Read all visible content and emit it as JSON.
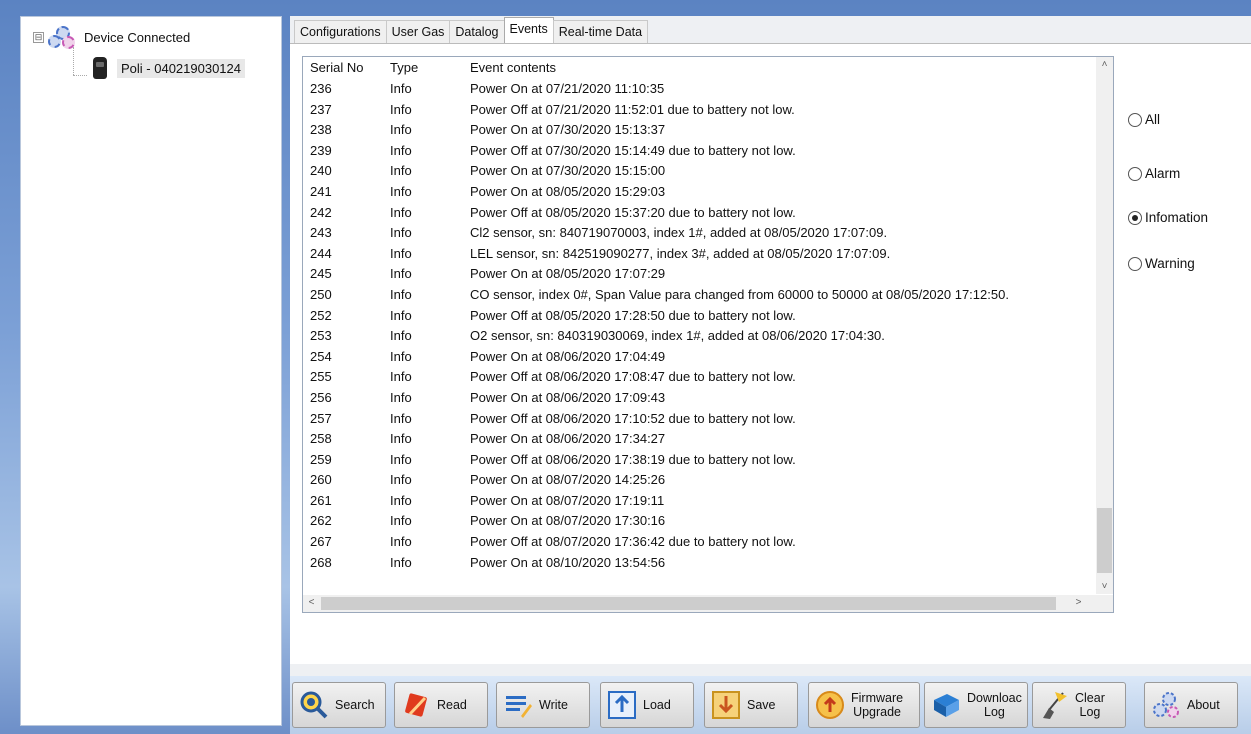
{
  "tree": {
    "root_label": "Device Connected",
    "expander": "⊟",
    "child_label": "Poli - 040219030124"
  },
  "tabs": [
    "Configurations",
    "User Gas",
    "Datalog",
    "Events",
    "Real-time Data"
  ],
  "active_tab": "Events",
  "events_table": {
    "headers": {
      "serial": "Serial No",
      "type": "Type",
      "contents": "Event contents"
    },
    "rows": [
      {
        "serial": "236",
        "type": "Info",
        "contents": "Power On at 07/21/2020 11:10:35"
      },
      {
        "serial": "237",
        "type": "Info",
        "contents": "Power Off at 07/21/2020 11:52:01 due to battery not low."
      },
      {
        "serial": "238",
        "type": "Info",
        "contents": "Power On at 07/30/2020 15:13:37"
      },
      {
        "serial": "239",
        "type": "Info",
        "contents": "Power Off at 07/30/2020 15:14:49 due to battery not low."
      },
      {
        "serial": "240",
        "type": "Info",
        "contents": "Power On at 07/30/2020 15:15:00"
      },
      {
        "serial": "241",
        "type": "Info",
        "contents": "Power On at 08/05/2020 15:29:03"
      },
      {
        "serial": "242",
        "type": "Info",
        "contents": "Power Off at 08/05/2020 15:37:20 due to battery not low."
      },
      {
        "serial": "243",
        "type": "Info",
        "contents": "Cl2 sensor, sn: 840719070003, index 1#, added at 08/05/2020 17:07:09."
      },
      {
        "serial": "244",
        "type": "Info",
        "contents": "LEL sensor, sn: 842519090277, index 3#, added at 08/05/2020 17:07:09."
      },
      {
        "serial": "245",
        "type": "Info",
        "contents": "Power On at 08/05/2020 17:07:29"
      },
      {
        "serial": "250",
        "type": "Info",
        "contents": "CO sensor, index 0#, Span Value para changed from 60000 to 50000 at 08/05/2020 17:12:50."
      },
      {
        "serial": "252",
        "type": "Info",
        "contents": "Power Off at 08/05/2020 17:28:50 due to battery not low."
      },
      {
        "serial": "253",
        "type": "Info",
        "contents": "O2 sensor, sn: 840319030069, index 1#, added at 08/06/2020 17:04:30."
      },
      {
        "serial": "254",
        "type": "Info",
        "contents": "Power On at 08/06/2020 17:04:49"
      },
      {
        "serial": "255",
        "type": "Info",
        "contents": "Power Off at 08/06/2020 17:08:47 due to battery not low."
      },
      {
        "serial": "256",
        "type": "Info",
        "contents": "Power On at 08/06/2020 17:09:43"
      },
      {
        "serial": "257",
        "type": "Info",
        "contents": "Power Off at 08/06/2020 17:10:52 due to battery not low."
      },
      {
        "serial": "258",
        "type": "Info",
        "contents": "Power On at 08/06/2020 17:34:27"
      },
      {
        "serial": "259",
        "type": "Info",
        "contents": "Power Off at 08/06/2020 17:38:19 due to battery not low."
      },
      {
        "serial": "260",
        "type": "Info",
        "contents": "Power On at 08/07/2020 14:25:26"
      },
      {
        "serial": "261",
        "type": "Info",
        "contents": "Power On at 08/07/2020 17:19:11"
      },
      {
        "serial": "262",
        "type": "Info",
        "contents": "Power On at 08/07/2020 17:30:16"
      },
      {
        "serial": "267",
        "type": "Info",
        "contents": "Power Off at 08/07/2020 17:36:42 due to battery not low."
      },
      {
        "serial": "268",
        "type": "Info",
        "contents": "Power On at 08/10/2020 13:54:56"
      }
    ]
  },
  "scroll": {
    "up": "˄",
    "down": "˅",
    "left": "<",
    "right": ">"
  },
  "filters": [
    {
      "label": "All",
      "checked": false
    },
    {
      "label": "Alarm",
      "checked": false
    },
    {
      "label": "Infomation",
      "checked": true
    },
    {
      "label": "Warning",
      "checked": false
    }
  ],
  "toolbar": {
    "search": "Search",
    "read": "Read",
    "write": "Write",
    "load": "Load",
    "save": "Save",
    "firmware_1": "Firmware",
    "firmware_2": "Upgrade",
    "download_1": "Downloac",
    "download_2": "Log",
    "clear_1": "Clear",
    "clear_2": "Log",
    "about": "About"
  },
  "icons": {
    "search": "magnifier-icon",
    "read": "read-icon",
    "write": "write-icon",
    "load": "load-icon",
    "save": "save-icon",
    "firmware": "upgrade-icon",
    "download": "book-icon",
    "clear": "broom-icon",
    "about": "gear-icon"
  },
  "colors": {
    "accent": "#4b74c9",
    "toolbar_bg": "#c8d9ef"
  }
}
